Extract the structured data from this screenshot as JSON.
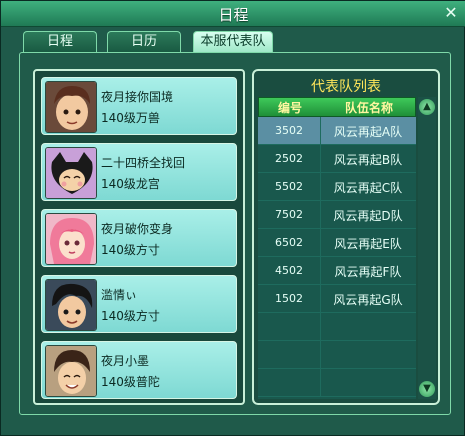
{
  "window": {
    "title": "日程",
    "close_glyph": "✕"
  },
  "tabs": [
    {
      "label": "日程",
      "active": false
    },
    {
      "label": "日历",
      "active": false
    },
    {
      "label": "本服代表队",
      "active": true
    }
  ],
  "members": [
    {
      "name": "夜月接你国境",
      "info": "140级万兽",
      "avatar": "boy-brown-hair-avatar"
    },
    {
      "name": "二十四桥全找回",
      "info": "140级龙宫",
      "avatar": "masked-cat-avatar"
    },
    {
      "name": "夜月破你变身",
      "info": "140级方寸",
      "avatar": "pink-hair-girl-avatar"
    },
    {
      "name": "滥情ぃ",
      "info": "140级方寸",
      "avatar": "black-hair-boy-avatar"
    },
    {
      "name": "夜月小墨",
      "info": "140级普陀",
      "avatar": "smiling-boy-avatar"
    }
  ],
  "team_list": {
    "title": "代表队列表",
    "col_number": "编号",
    "col_name": "队伍名称",
    "rows": [
      {
        "num": "3502",
        "name": "风云再起A队",
        "selected": true
      },
      {
        "num": "2502",
        "name": "风云再起B队",
        "selected": false
      },
      {
        "num": "5502",
        "name": "风云再起C队",
        "selected": false
      },
      {
        "num": "7502",
        "name": "风云再起D队",
        "selected": false
      },
      {
        "num": "6502",
        "name": "风云再起E队",
        "selected": false
      },
      {
        "num": "4502",
        "name": "风云再起F队",
        "selected": false
      },
      {
        "num": "1502",
        "name": "风云再起G队",
        "selected": false
      }
    ],
    "empty_rows": 3
  },
  "colors": {
    "title_gold": "#ffe65a",
    "selected_row": "#5b8fa3",
    "member_card": "#a9efe8"
  }
}
